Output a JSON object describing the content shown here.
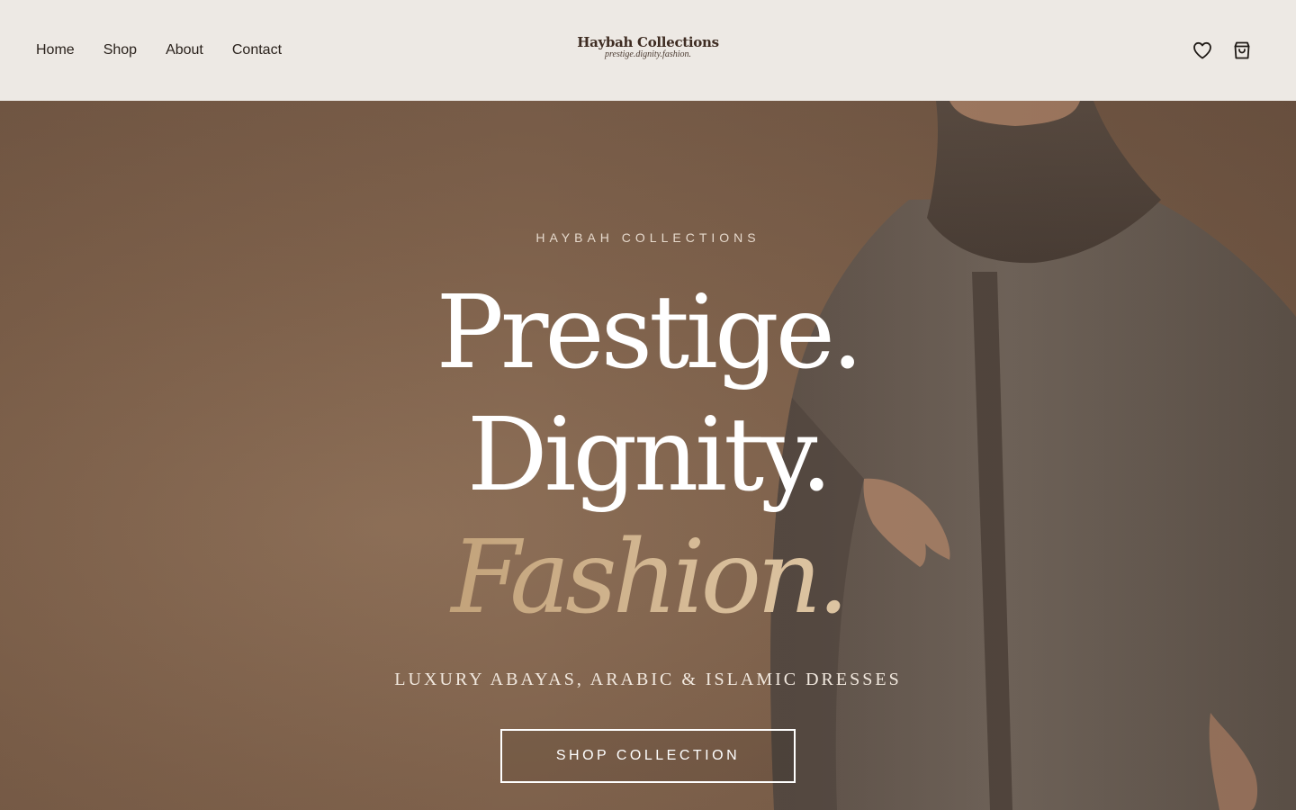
{
  "nav": {
    "items": [
      {
        "label": "Home"
      },
      {
        "label": "Shop"
      },
      {
        "label": "About"
      },
      {
        "label": "Contact"
      }
    ]
  },
  "brand": {
    "name": "Haybah Collections",
    "tagline": "prestige.dignity.fashion."
  },
  "header_icons": [
    "heart-icon",
    "shopping-bag-icon"
  ],
  "hero": {
    "eyebrow": "HAYBAH COLLECTIONS",
    "headline_line1": "Prestige.",
    "headline_line2": "Dignity.",
    "headline_line3": "Fashion.",
    "subline": "LUXURY ABAYAS, ARABIC & ISLAMIC DRESSES",
    "cta_label": "SHOP COLLECTION"
  },
  "colors": {
    "header_bg": "#ede9e4",
    "hero_bg": "#85674f",
    "accent_gold": "#cfb38e",
    "text_dark": "#2a221c"
  }
}
